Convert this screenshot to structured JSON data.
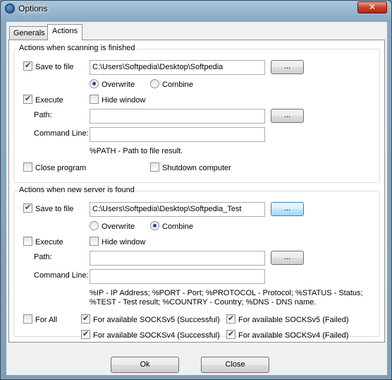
{
  "window": {
    "title": "Options",
    "close_glyph": "✕"
  },
  "tabs": [
    {
      "label": "Generals",
      "active": false
    },
    {
      "label": "Actions",
      "active": true
    }
  ],
  "scan_finished": {
    "legend": "Actions when scanning is finished",
    "save_to_file": {
      "label": "Save to file",
      "checked": true,
      "path": "C:\\Users\\Softpedia\\Desktop\\Softpedia",
      "browse": "..."
    },
    "overwrite": {
      "label": "Overwrite",
      "selected": true
    },
    "combine": {
      "label": "Combine",
      "selected": false
    },
    "execute": {
      "label": "Execute",
      "checked": true
    },
    "hide_window": {
      "label": "Hide window",
      "checked": false
    },
    "path": {
      "label": "Path:",
      "value": "",
      "browse": "..."
    },
    "command_line": {
      "label": "Command Line:",
      "value": ""
    },
    "hint": "%PATH - Path to file result.",
    "close_program": {
      "label": "Close program",
      "checked": false
    },
    "shutdown": {
      "label": "Shutdown computer",
      "checked": false
    }
  },
  "server_found": {
    "legend": "Actions when new server is found",
    "save_to_file": {
      "label": "Save to file",
      "checked": true,
      "path": "C:\\Users\\Softpedia\\Desktop\\Softpedia_Test",
      "browse": "..."
    },
    "overwrite": {
      "label": "Overwrite",
      "selected": false
    },
    "combine": {
      "label": "Combine",
      "selected": true
    },
    "execute": {
      "label": "Execute",
      "checked": false
    },
    "hide_window": {
      "label": "Hide window",
      "checked": false
    },
    "path": {
      "label": "Path:",
      "value": "",
      "browse": "..."
    },
    "command_line": {
      "label": "Command Line:",
      "value": ""
    },
    "hint_line1": "%IP - IP Address; %PORT - Port; %PROTOCOL - Protocol; %STATUS - Status;",
    "hint_line2": "%TEST - Test result; %COUNTRY - Country; %DNS - DNS name.",
    "for_all": {
      "label": "For All",
      "checked": false
    },
    "socks5_ok": {
      "label": "For available SOCKSv5 (Successful)",
      "checked": true
    },
    "socks5_fail": {
      "label": "For available SOCKSv5 (Failed)",
      "checked": true
    },
    "socks4_ok": {
      "label": "For available SOCKSv4 (Successful)",
      "checked": true
    },
    "socks4_fail": {
      "label": "For available SOCKSv4 (Failed)",
      "checked": true
    }
  },
  "footer": {
    "ok": "Ok",
    "close": "Close"
  },
  "colors": {
    "accent": "#3c7fb1",
    "frame": "#88a9c4",
    "close_red": "#c9452f"
  }
}
